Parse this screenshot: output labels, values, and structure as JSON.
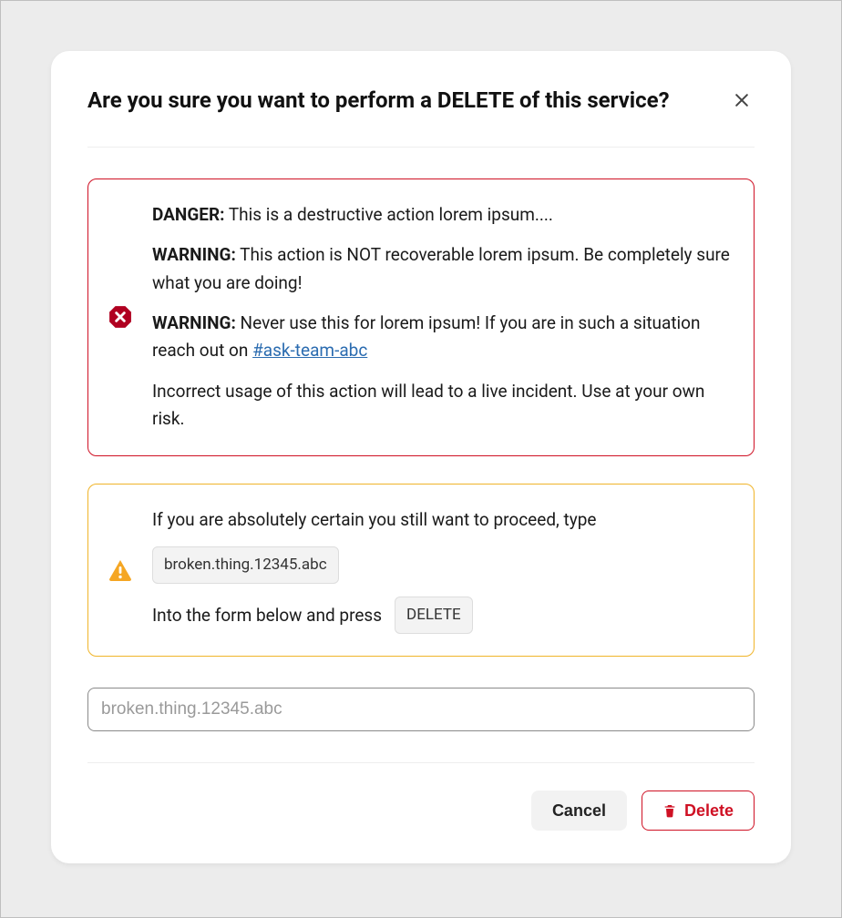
{
  "modal": {
    "title": "Are you sure you want to perform a DELETE of this service?"
  },
  "danger": {
    "p1_label": "DANGER:",
    "p1_text": " This is a destructive action lorem ipsum....",
    "p2_label": "WARNING:",
    "p2_text": " This action is NOT recoverable lorem ipsum. Be completely sure what you are doing!",
    "p3_label": "WARNING:",
    "p3_text_a": " Never use this for lorem ipsum! If you are in such a situation reach out on ",
    "p3_link": "#ask-team-abc",
    "p4_text": "Incorrect usage of this action will lead to a live incident. Use at your own risk."
  },
  "warn": {
    "line1": "If you are absolutely certain you still want to proceed, type",
    "chip_value": "broken.thing.12345.abc",
    "line2_text": "Into the form below and press",
    "line2_button": "DELETE"
  },
  "input": {
    "placeholder": "broken.thing.12345.abc"
  },
  "footer": {
    "cancel": "Cancel",
    "delete": "Delete"
  }
}
